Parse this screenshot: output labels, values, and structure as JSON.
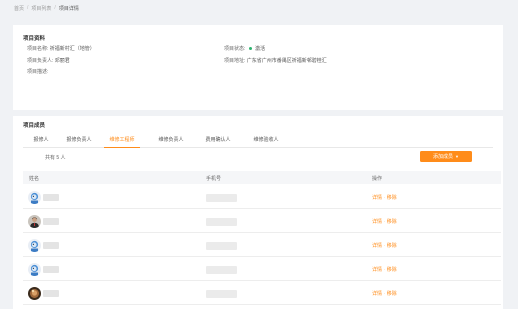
{
  "breadcrumb": {
    "home": "首页",
    "list": "项目列表",
    "current": "项目详情"
  },
  "info": {
    "title": "项目资料",
    "name_label": "项目名称:",
    "name_value": "祈福新村汇（地管）",
    "status_label": "项目状态:",
    "status_value": "激活",
    "status_color": "#2fb36f",
    "owner_label": "项目负责人:",
    "owner_value": "邓丽君",
    "address_label": "项目地址:",
    "address_value": "广东省广州市番禺区祈福新邨碧桂汇",
    "desc_label": "项目描述:"
  },
  "team": {
    "title": "项目成员",
    "tabs": [
      "报修人",
      "报修负责人",
      "维修工程师",
      "维修负责人",
      "费用确认人",
      "维修验收人"
    ],
    "active_tab": "维修工程师",
    "total": "共有 5 人",
    "add_button": "添加成员",
    "columns": {
      "name": "姓名",
      "phone": "手机号",
      "ops": "操作"
    },
    "row_actions": {
      "detail": "详情",
      "remove": "移除"
    },
    "rows": [
      {
        "avatar": "blue-cartoon"
      },
      {
        "avatar": "person-photo"
      },
      {
        "avatar": "blue-cartoon"
      },
      {
        "avatar": "blue-cartoon"
      },
      {
        "avatar": "brown-photo"
      }
    ]
  },
  "colors": {
    "accent": "#ff8c1a",
    "status_green": "#2fb36f"
  }
}
